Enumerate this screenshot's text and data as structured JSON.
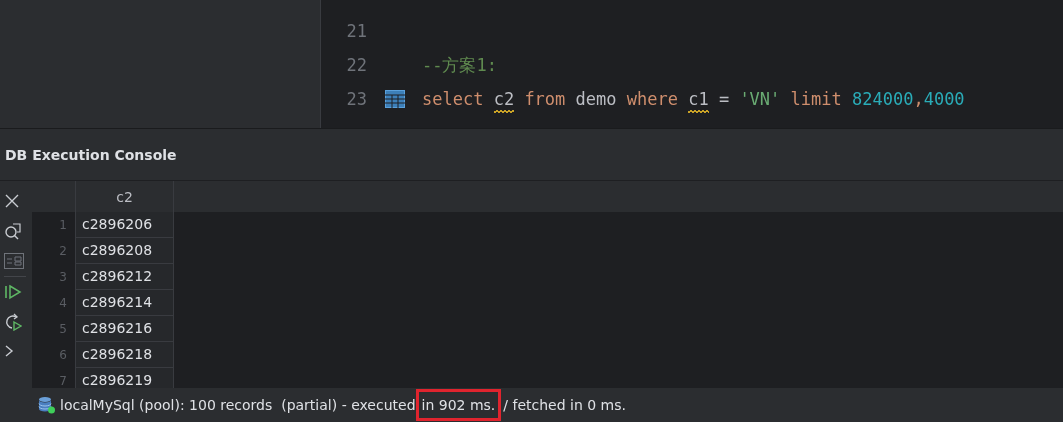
{
  "editor": {
    "lines": [
      {
        "number": "21",
        "table_icon": false
      },
      {
        "number": "22",
        "table_icon": false,
        "tokens": [
          {
            "text": "--方案1:",
            "kind": "comment",
            "warning": false
          }
        ]
      },
      {
        "number": "23",
        "table_icon": true,
        "tokens": [
          {
            "text": "select ",
            "kind": "keyword",
            "warning": false
          },
          {
            "text": "c2",
            "kind": "plain",
            "warning": true
          },
          {
            "text": " from",
            "kind": "keyword",
            "warning": false
          },
          {
            "text": " demo ",
            "kind": "plain",
            "warning": false
          },
          {
            "text": "where ",
            "kind": "keyword",
            "warning": false
          },
          {
            "text": "c1",
            "kind": "plain",
            "warning": true
          },
          {
            "text": " = ",
            "kind": "plain",
            "warning": false
          },
          {
            "text": "'VN'",
            "kind": "string",
            "warning": false
          },
          {
            "text": " limit ",
            "kind": "keyword",
            "warning": false
          },
          {
            "text": "824000",
            "kind": "number",
            "warning": false
          },
          {
            "text": ",",
            "kind": "keyword",
            "warning": false
          },
          {
            "text": "4000",
            "kind": "number",
            "warning": false
          }
        ]
      }
    ]
  },
  "console": {
    "title": "DB Execution Console",
    "toolbar": [
      {
        "kind": "close"
      },
      {
        "kind": "search"
      },
      {
        "kind": "layout"
      },
      {
        "kind": "run"
      },
      {
        "kind": "rerun"
      },
      {
        "kind": "more"
      }
    ],
    "table": {
      "columns": [
        "c2"
      ],
      "rows": [
        {
          "number": "1",
          "cells": [
            "c2896206"
          ]
        },
        {
          "number": "2",
          "cells": [
            "c2896208"
          ]
        },
        {
          "number": "3",
          "cells": [
            "c2896212"
          ]
        },
        {
          "number": "4",
          "cells": [
            "c2896214"
          ]
        },
        {
          "number": "5",
          "cells": [
            "c2896216"
          ]
        },
        {
          "number": "6",
          "cells": [
            "c2896218"
          ]
        },
        {
          "number": "7",
          "cells": [
            "c2896219"
          ]
        }
      ]
    },
    "status": {
      "before": "localMySql (pool): 100 records  (partial) - executed",
      "highlighted": "in 902 ms.",
      "after": "/ fetched in 0 ms."
    }
  }
}
